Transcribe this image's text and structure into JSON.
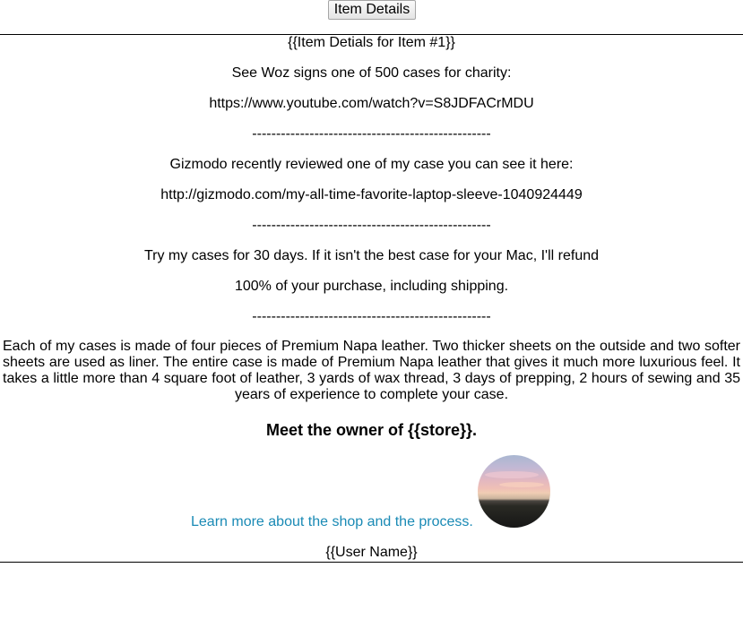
{
  "header": {
    "button_label": "Item Details"
  },
  "details": {
    "title": "{{Item Detials for Item #1}}",
    "woz_text": "See Woz signs one of 500 cases for charity:",
    "woz_url": "https://www.youtube.com/watch?v=S8JDFACrMDU",
    "separator": "--------------------------------------------------",
    "gizmodo_text": "Gizmodo recently reviewed one of my case you can see it here:",
    "gizmodo_url": "http://gizmodo.com/my-all-time-favorite-laptop-sleeve-1040924449",
    "trial_line1": "Try my cases for 30 days. If it isn't the best case for your Mac, I'll refund",
    "trial_line2": "100% of your purchase, including shipping.",
    "description": "Each of my cases is made of four pieces of Premium Napa leather. Two thicker sheets on the outside and two softer sheets are used as liner. The entire case is made of Premium Napa leather that gives it much more luxurious feel. It takes a little more than 4 square foot of leather, 3 yards of wax thread, 3 days of prepping, 2 hours of sewing and 35 years of experience to complete your case."
  },
  "owner": {
    "heading": "Meet the owner of {{store}}.",
    "link_text": "Learn more about the shop and the process.",
    "link_color": "#1a8ab5",
    "user_name": "{{User Name}}"
  }
}
